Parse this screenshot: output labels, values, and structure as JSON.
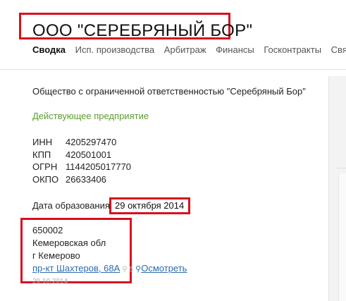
{
  "company": {
    "title": "ООО \"СЕРЕБРЯНЫЙ БОР\"",
    "full_name": "Общество с ограниченной ответственностью \"Серебряный Бор\"",
    "status": "Действующее предприятие"
  },
  "tabs": [
    {
      "label": "Сводка",
      "active": true
    },
    {
      "label": "Исп. производства",
      "active": false
    },
    {
      "label": "Арбитраж",
      "active": false
    },
    {
      "label": "Финансы",
      "active": false
    },
    {
      "label": "Госконтракты",
      "active": false
    },
    {
      "label": "Связи",
      "active": false
    }
  ],
  "codes": [
    {
      "label": "ИНН",
      "value": "4205297470"
    },
    {
      "label": "КПП",
      "value": "420501001"
    },
    {
      "label": "ОГРН",
      "value": "1144205017770"
    },
    {
      "label": "ОКПО",
      "value": "26633406"
    }
  ],
  "registration": {
    "label": "Дата образования",
    "date": "29 октября 2014"
  },
  "address": {
    "postcode": "650002",
    "region": "Кемеровская обл",
    "city": "г Кемерово",
    "street": "пр-кт Шахтеров, 68А",
    "faint_count": "5",
    "view_label": "Осмотреть",
    "date": "29.10.2014"
  },
  "colors": {
    "highlight": "#d8101e",
    "link": "#2b6cb0",
    "status": "#5a9e2f"
  },
  "icons": {
    "map_pin": "map-pin-icon",
    "search": "search-icon"
  }
}
